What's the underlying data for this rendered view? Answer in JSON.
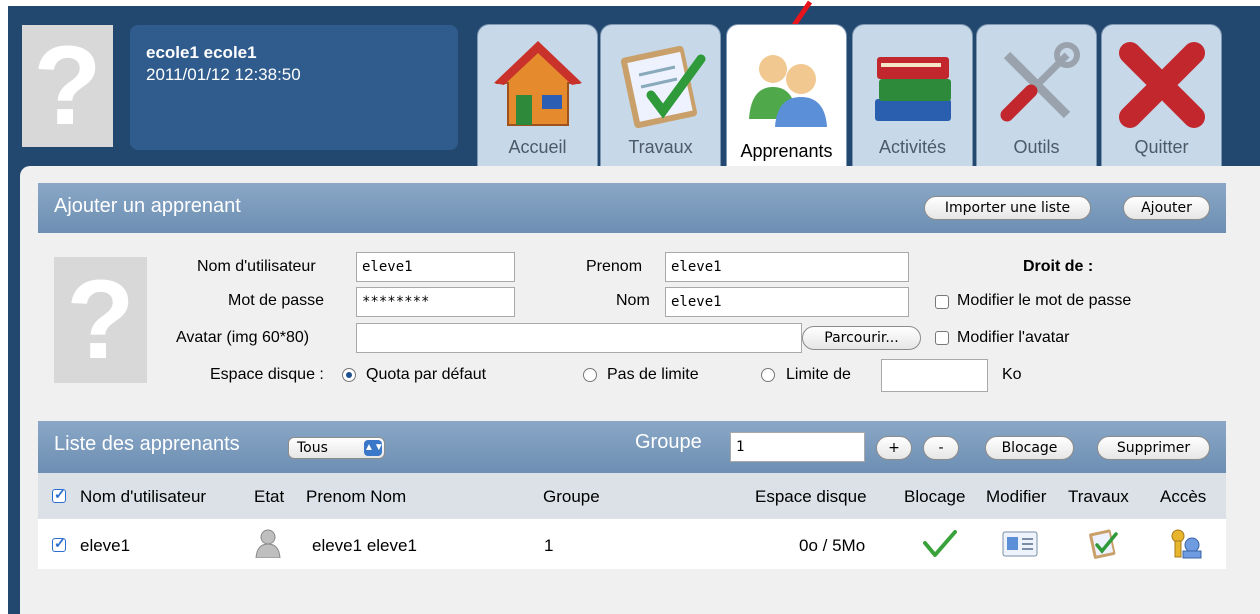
{
  "header": {
    "user_name": "ecole1 ecole1",
    "datetime": "2011/01/12 12:38:50"
  },
  "tabs": [
    {
      "label": "Accueil",
      "icon": "house-icon"
    },
    {
      "label": "Travaux",
      "icon": "clipboard-check-icon"
    },
    {
      "label": "Apprenants",
      "icon": "users-icon",
      "active": true
    },
    {
      "label": "Activités",
      "icon": "books-icon"
    },
    {
      "label": "Outils",
      "icon": "tools-icon"
    },
    {
      "label": "Quitter",
      "icon": "close-x-icon"
    }
  ],
  "add_section": {
    "title": "Ajouter un apprenant",
    "import_button": "Importer une liste",
    "add_button": "Ajouter",
    "username_label": "Nom d'utilisateur",
    "username_value": "eleve1",
    "password_label": "Mot de passe",
    "password_value": "********",
    "avatar_label": "Avatar (img 60*80)",
    "avatar_value": "",
    "browse_button": "Parcourir...",
    "firstname_label": "Prenom",
    "firstname_value": "eleve1",
    "lastname_label": "Nom",
    "lastname_value": "eleve1",
    "rights_title": "Droit de :",
    "right_password": "Modifier le mot de passe",
    "right_avatar": "Modifier l'avatar",
    "disk_label": "Espace disque :",
    "quota_default": "Quota par défaut",
    "no_limit": "Pas de limite",
    "limit_of": "Limite de",
    "limit_value": "",
    "unit": "Ko"
  },
  "list_section": {
    "title": "Liste des apprenants",
    "filter_value": "Tous",
    "group_label": "Groupe",
    "group_value": "1",
    "plus_button": "+",
    "minus_button": "-",
    "block_button": "Blocage",
    "delete_button": "Supprimer",
    "columns": [
      "Nom d'utilisateur",
      "Etat",
      "Prenom Nom",
      "Groupe",
      "Espace disque",
      "Blocage",
      "Modifier",
      "Travaux",
      "Accès"
    ],
    "rows": [
      {
        "username": "eleve1",
        "name": "eleve1 eleve1",
        "group": "1",
        "disk": "0o / 5Mo"
      }
    ]
  },
  "colors": {
    "background": "#23486f",
    "panel_header": "#7a9abd",
    "tab": "#c7d8e8"
  }
}
